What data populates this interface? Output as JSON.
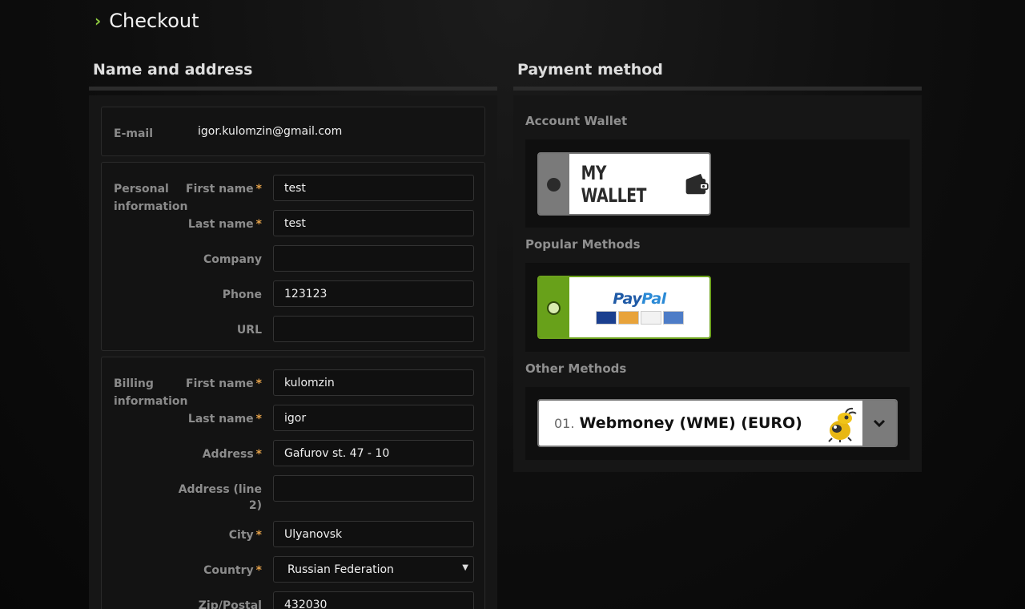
{
  "header": {
    "title": "Checkout"
  },
  "address": {
    "title": "Name and address",
    "email": {
      "label": "E-mail",
      "value": "igor.kulomzin@gmail.com"
    },
    "personal": {
      "label": "Personal information",
      "fields": [
        {
          "label": "First name",
          "required": "*",
          "value": "test"
        },
        {
          "label": "Last name",
          "required": "*",
          "value": "test"
        },
        {
          "label": "Company",
          "required": "",
          "value": ""
        },
        {
          "label": "Phone",
          "required": "",
          "value": "123123"
        },
        {
          "label": "URL",
          "required": "",
          "value": ""
        }
      ]
    },
    "billing": {
      "label": "Billing information",
      "fields": [
        {
          "label": "First name",
          "required": "*",
          "value": "kulomzin"
        },
        {
          "label": "Last name",
          "required": "*",
          "value": "igor"
        },
        {
          "label": "Address",
          "required": "*",
          "value": "Gafurov st. 47 - 10"
        },
        {
          "label": "Address (line 2)",
          "required": "",
          "value": ""
        },
        {
          "label": "City",
          "required": "*",
          "value": "Ulyanovsk"
        },
        {
          "label": "Country",
          "required": "*",
          "value": "Russian Federation"
        },
        {
          "label": "Zip/Postal",
          "required": "",
          "value": "432030"
        }
      ]
    }
  },
  "payment": {
    "title": "Payment method",
    "wallet_section": "Account Wallet",
    "wallet_card": "MY WALLET",
    "popular_section": "Popular Methods",
    "paypal_logo_pay": "Pay",
    "paypal_logo_pal": "Pal",
    "other_section": "Other Methods",
    "other_select": {
      "number": "01.",
      "name": "Webmoney (WME) (EURO)"
    }
  },
  "colors": {
    "accent_green": "#6da31d",
    "required_star": "#e5a24a",
    "paypal_blue": "#1f5aa6"
  },
  "icons": [
    "chevron-right-icon",
    "wallet-icon",
    "radio-dot-icon",
    "webmoney-bug-icon",
    "chevron-down-icon",
    "select-caret-icon"
  ]
}
